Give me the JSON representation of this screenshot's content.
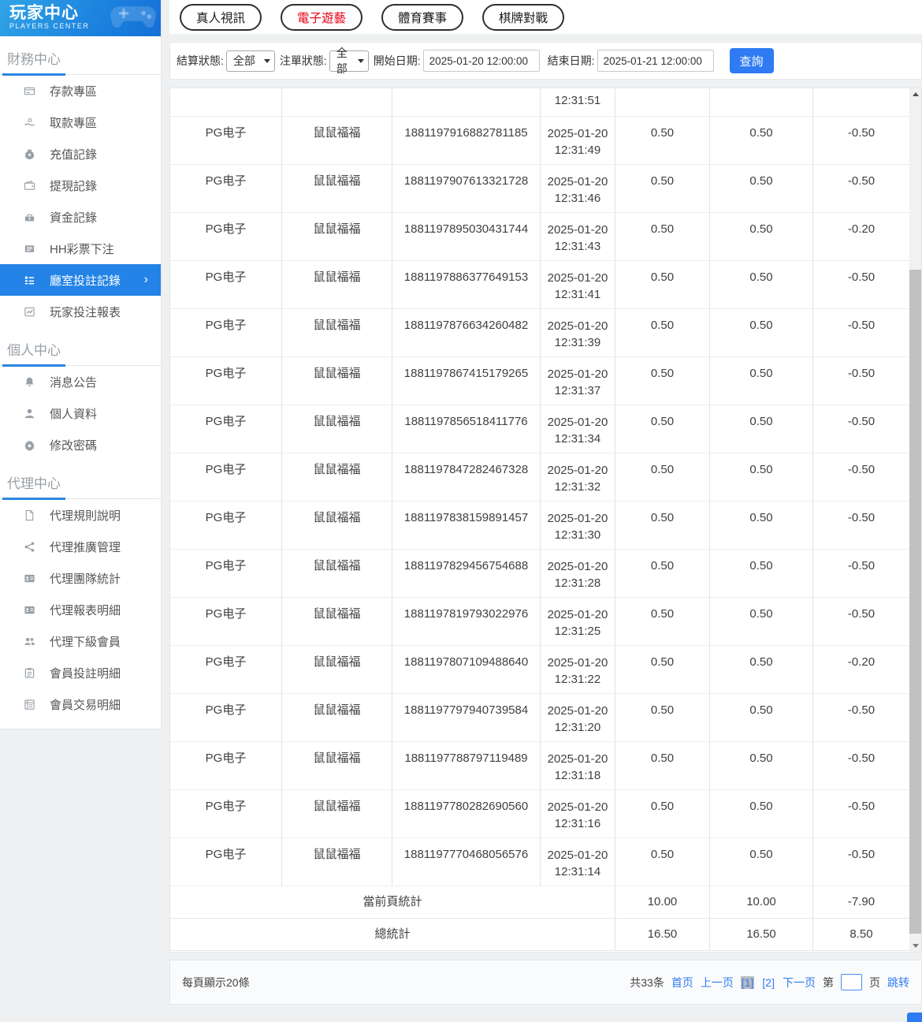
{
  "colors": {
    "accent_blue": "#2e7bf3",
    "sidebar_active_blue": "#2383e6",
    "tab_active_red": "#e60012",
    "table_vertical_border_pink": "#f5dbdb",
    "header_gradient_blue": "#1b82de"
  },
  "sidebar": {
    "logo": {
      "title": "玩家中心",
      "subtitle": "PLAYERS CENTER"
    },
    "sections": [
      {
        "title": "財務中心",
        "items": [
          {
            "label": "存款專區",
            "icon": "deposit-card-icon"
          },
          {
            "label": "取款專區",
            "icon": "withdraw-hand-icon"
          },
          {
            "label": "充值記錄",
            "icon": "moneybag-icon"
          },
          {
            "label": "提現記錄",
            "icon": "wallet-icon"
          },
          {
            "label": "資金記錄",
            "icon": "purse-icon"
          },
          {
            "label": "HH彩票下注",
            "icon": "lottery-ticket-icon"
          },
          {
            "label": "廳室投註記錄",
            "icon": "bet-records-list-icon",
            "active": true,
            "chevron": "›"
          },
          {
            "label": "玩家投注報表",
            "icon": "report-chart-icon"
          }
        ]
      },
      {
        "title": "個人中心",
        "items": [
          {
            "label": "消息公告",
            "icon": "bell-icon"
          },
          {
            "label": "個人資料",
            "icon": "user-icon"
          },
          {
            "label": "修改密碼",
            "icon": "gear-icon"
          }
        ]
      },
      {
        "title": "代理中心",
        "items": [
          {
            "label": "代理規則說明",
            "icon": "document-icon"
          },
          {
            "label": "代理推廣管理",
            "icon": "share-icon"
          },
          {
            "label": "代理團隊統計",
            "icon": "idcard-icon"
          },
          {
            "label": "代理報表明細",
            "icon": "idcard-icon"
          },
          {
            "label": "代理下級會員",
            "icon": "users-icon"
          },
          {
            "label": "會員投註明細",
            "icon": "clipboard-icon"
          },
          {
            "label": "會員交易明細",
            "icon": "ledger-icon"
          }
        ]
      }
    ]
  },
  "tabs": [
    {
      "label": "真人視訊"
    },
    {
      "label": "電子遊藝",
      "active": true
    },
    {
      "label": "體育賽事"
    },
    {
      "label": "棋牌對戰"
    }
  ],
  "filters": {
    "settle_label": "結算狀態:",
    "settle_value": "全部",
    "order_label": "注單狀態:",
    "order_value": "全部",
    "start_label": "開始日期:",
    "start_value": "2025-01-20 12:00:00",
    "end_label": "結束日期:",
    "end_value": "2025-01-21 12:00:00",
    "search_button": "查詢"
  },
  "table": {
    "partial_row_time": "12:31:51",
    "rows": [
      {
        "hall": "PG电子",
        "game": "鼠鼠福福",
        "order": "1881197916882781185",
        "date": "2025-01-20",
        "time": "12:31:49",
        "bet": "0.50",
        "valid": "0.50",
        "winloss": "-0.50"
      },
      {
        "hall": "PG电子",
        "game": "鼠鼠福福",
        "order": "1881197907613321728",
        "date": "2025-01-20",
        "time": "12:31:46",
        "bet": "0.50",
        "valid": "0.50",
        "winloss": "-0.50"
      },
      {
        "hall": "PG电子",
        "game": "鼠鼠福福",
        "order": "1881197895030431744",
        "date": "2025-01-20",
        "time": "12:31:43",
        "bet": "0.50",
        "valid": "0.50",
        "winloss": "-0.20"
      },
      {
        "hall": "PG电子",
        "game": "鼠鼠福福",
        "order": "1881197886377649153",
        "date": "2025-01-20",
        "time": "12:31:41",
        "bet": "0.50",
        "valid": "0.50",
        "winloss": "-0.50"
      },
      {
        "hall": "PG电子",
        "game": "鼠鼠福福",
        "order": "1881197876634260482",
        "date": "2025-01-20",
        "time": "12:31:39",
        "bet": "0.50",
        "valid": "0.50",
        "winloss": "-0.50"
      },
      {
        "hall": "PG电子",
        "game": "鼠鼠福福",
        "order": "1881197867415179265",
        "date": "2025-01-20",
        "time": "12:31:37",
        "bet": "0.50",
        "valid": "0.50",
        "winloss": "-0.50"
      },
      {
        "hall": "PG电子",
        "game": "鼠鼠福福",
        "order": "1881197856518411776",
        "date": "2025-01-20",
        "time": "12:31:34",
        "bet": "0.50",
        "valid": "0.50",
        "winloss": "-0.50"
      },
      {
        "hall": "PG电子",
        "game": "鼠鼠福福",
        "order": "1881197847282467328",
        "date": "2025-01-20",
        "time": "12:31:32",
        "bet": "0.50",
        "valid": "0.50",
        "winloss": "-0.50"
      },
      {
        "hall": "PG电子",
        "game": "鼠鼠福福",
        "order": "1881197838159891457",
        "date": "2025-01-20",
        "time": "12:31:30",
        "bet": "0.50",
        "valid": "0.50",
        "winloss": "-0.50"
      },
      {
        "hall": "PG电子",
        "game": "鼠鼠福福",
        "order": "1881197829456754688",
        "date": "2025-01-20",
        "time": "12:31:28",
        "bet": "0.50",
        "valid": "0.50",
        "winloss": "-0.50"
      },
      {
        "hall": "PG电子",
        "game": "鼠鼠福福",
        "order": "1881197819793022976",
        "date": "2025-01-20",
        "time": "12:31:25",
        "bet": "0.50",
        "valid": "0.50",
        "winloss": "-0.50"
      },
      {
        "hall": "PG电子",
        "game": "鼠鼠福福",
        "order": "1881197807109488640",
        "date": "2025-01-20",
        "time": "12:31:22",
        "bet": "0.50",
        "valid": "0.50",
        "winloss": "-0.20"
      },
      {
        "hall": "PG电子",
        "game": "鼠鼠福福",
        "order": "1881197797940739584",
        "date": "2025-01-20",
        "time": "12:31:20",
        "bet": "0.50",
        "valid": "0.50",
        "winloss": "-0.50"
      },
      {
        "hall": "PG电子",
        "game": "鼠鼠福福",
        "order": "1881197788797119489",
        "date": "2025-01-20",
        "time": "12:31:18",
        "bet": "0.50",
        "valid": "0.50",
        "winloss": "-0.50"
      },
      {
        "hall": "PG电子",
        "game": "鼠鼠福福",
        "order": "1881197780282690560",
        "date": "2025-01-20",
        "time": "12:31:16",
        "bet": "0.50",
        "valid": "0.50",
        "winloss": "-0.50"
      },
      {
        "hall": "PG电子",
        "game": "鼠鼠福福",
        "order": "1881197770468056576",
        "date": "2025-01-20",
        "time": "12:31:14",
        "bet": "0.50",
        "valid": "0.50",
        "winloss": "-0.50"
      }
    ],
    "summary": [
      {
        "label": "當前頁統計",
        "bet": "10.00",
        "valid": "10.00",
        "winloss": "-7.90"
      },
      {
        "label": "總統計",
        "bet": "16.50",
        "valid": "16.50",
        "winloss": "8.50"
      }
    ]
  },
  "pagination": {
    "page_size_text": "每頁顯示20條",
    "total_text": "共33条",
    "first_label": "首页",
    "prev_label": "上一页",
    "pages": [
      {
        "label": "[1]",
        "active": true
      },
      {
        "label": "[2]"
      }
    ],
    "next_label": "下一页",
    "jump_prefix": "第",
    "jump_suffix": "页",
    "jump_button": "跳转",
    "jump_value": ""
  }
}
